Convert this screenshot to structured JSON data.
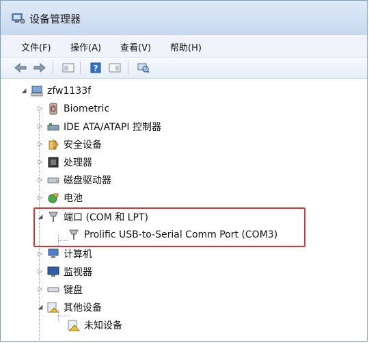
{
  "window": {
    "title": "设备管理器"
  },
  "menu": [
    "文件(F)",
    "操作(A)",
    "查看(V)",
    "帮助(H)"
  ],
  "toolbar": [
    "back-icon",
    "forward-icon",
    "properties-icon",
    "help-icon",
    "view-icon",
    "scan-hardware-icon"
  ],
  "tree": {
    "root": "zfw1133f",
    "items": [
      {
        "label": "Biometric",
        "icon": "biometric-icon",
        "expanded": false
      },
      {
        "label": "IDE ATA/ATAPI 控制器",
        "icon": "ide-controller-icon",
        "expanded": false
      },
      {
        "label": "安全设备",
        "icon": "security-device-icon",
        "expanded": false
      },
      {
        "label": "处理器",
        "icon": "processor-icon",
        "expanded": false
      },
      {
        "label": "磁盘驱动器",
        "icon": "disk-drive-icon",
        "expanded": false
      },
      {
        "label": "电池",
        "icon": "battery-icon",
        "expanded": false
      },
      {
        "label": "端口 (COM 和 LPT)",
        "icon": "port-icon",
        "expanded": true,
        "children": [
          {
            "label": "Prolific USB-to-Serial Comm Port (COM3)",
            "icon": "port-icon"
          }
        ]
      },
      {
        "label": "计算机",
        "icon": "computer-icon",
        "expanded": false
      },
      {
        "label": "监视器",
        "icon": "monitor-icon",
        "expanded": false
      },
      {
        "label": "键盘",
        "icon": "keyboard-icon",
        "expanded": false
      },
      {
        "label": "其他设备",
        "icon": "other-devices-icon",
        "expanded": true,
        "children": [
          {
            "label": "未知设备",
            "icon": "unknown-device-icon"
          }
        ]
      }
    ]
  },
  "colors": {
    "highlight": "#d9322f",
    "titlebar": "#c7d9ef"
  }
}
